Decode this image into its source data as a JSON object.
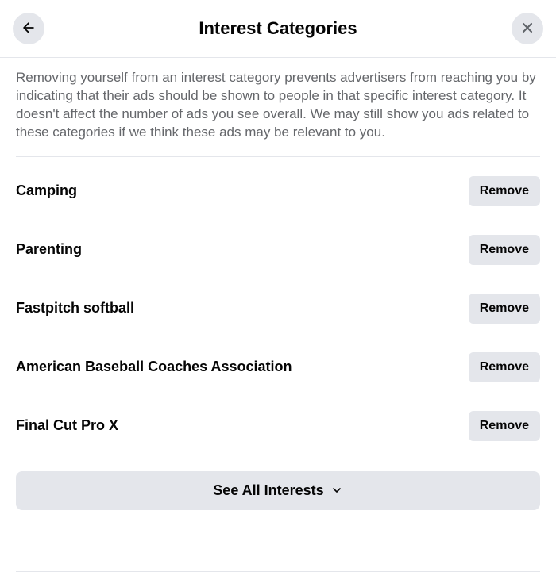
{
  "header": {
    "title": "Interest Categories"
  },
  "description": "Removing yourself from an interest category prevents advertisers from reaching you by indicating that their ads should be shown to people in that specific interest category. It doesn't affect the number of ads you see overall. We may still show you ads related to these categories if we think these ads may be relevant to you.",
  "remove_label": "Remove",
  "interests": [
    {
      "label": "Camping"
    },
    {
      "label": "Parenting"
    },
    {
      "label": "Fastpitch softball"
    },
    {
      "label": "American Baseball Coaches Association"
    },
    {
      "label": "Final Cut Pro X"
    }
  ],
  "see_all_label": "See All Interests"
}
